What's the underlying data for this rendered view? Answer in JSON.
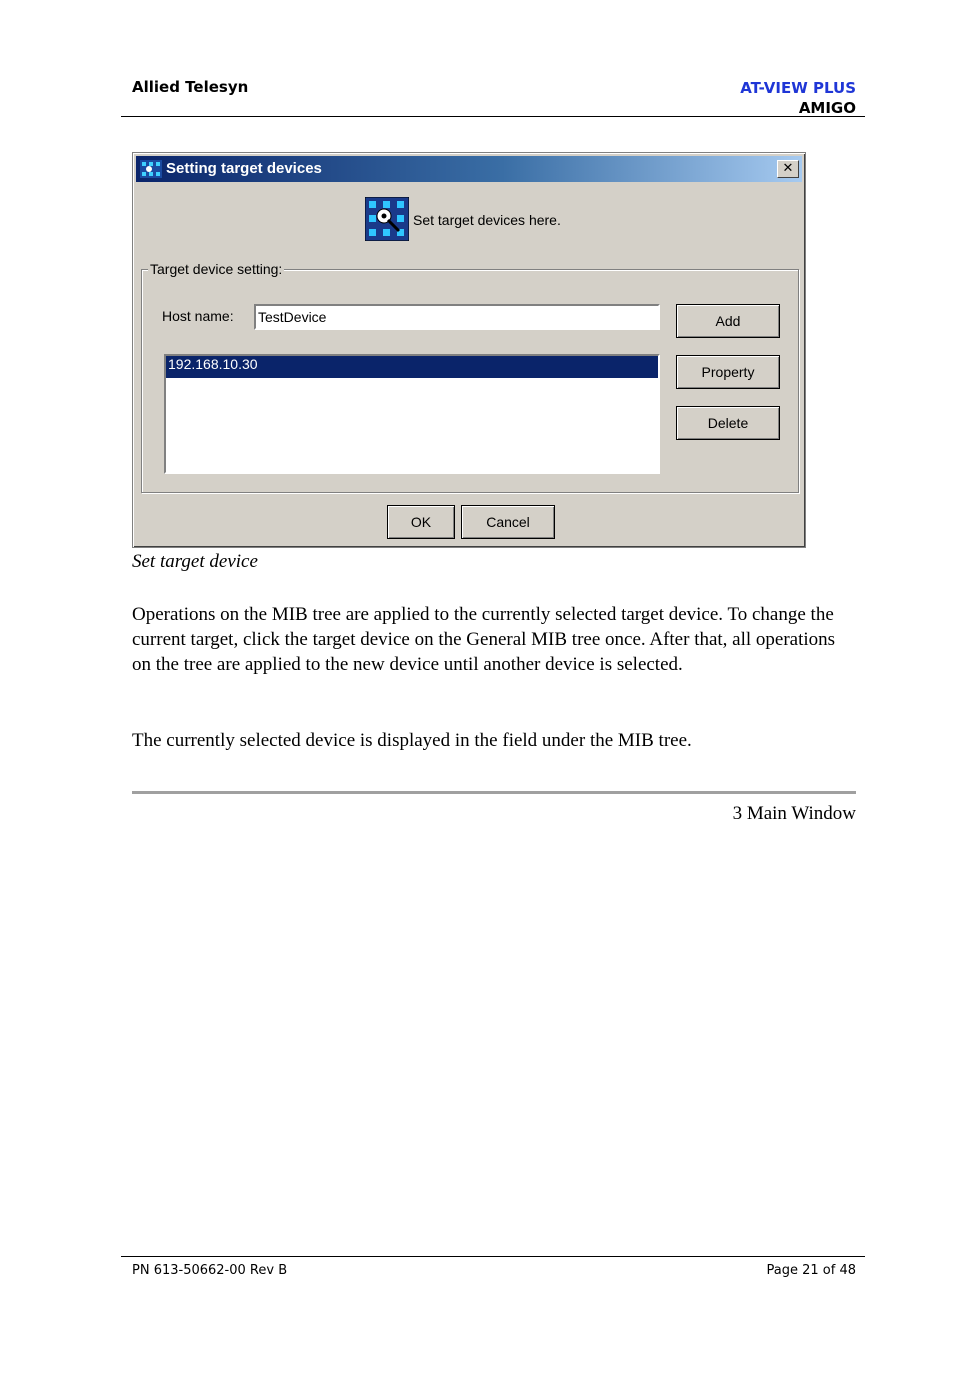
{
  "header": {
    "company": "Allied Telesyn",
    "product": "AT-VIEW PLUS",
    "subproduct": "AMIGO"
  },
  "dialog": {
    "title": "Setting target devices",
    "close_label": "✕",
    "banner_text": "Set target devices here.",
    "group_label": "Target device setting:",
    "host_label": "Host name:",
    "host_value": "TestDevice",
    "list_items": [
      "192.168.10.30"
    ],
    "buttons": {
      "add": "Add",
      "property": "Property",
      "delete": "Delete",
      "ok": "OK",
      "cancel": "Cancel"
    },
    "colors": {
      "title_bar": "#0a246a",
      "selection": "#0a246a",
      "face": "#d4d0c8"
    }
  },
  "caption": "Set target device",
  "paragraphs": [
    "Operations on the MIB tree are applied to the currently selected target device. To change the current target, click the target device on the General MIB tree once. After that, all operations on the tree are applied to the new device until another device is selected.",
    "The currently selected device is displayed in the field under the MIB tree."
  ],
  "section_label": "3 Main Window",
  "footer": {
    "part_number": "PN 613-50662-00 Rev B",
    "page": "Page 21 of 48"
  }
}
